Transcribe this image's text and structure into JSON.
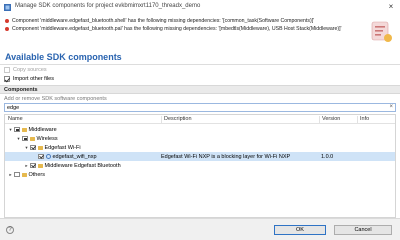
{
  "window": {
    "title": "Manage SDK components for project evkbmimxrt1170_threadx_demo",
    "icon": "app-icon",
    "close_label": "×"
  },
  "warnings": [
    "Component 'middleware.edgefast_bluetooth.shell' has the following missing dependencies: '[common_task(Software Components)]'",
    "Component 'middleware.edgefast_bluetooth.pal' has the following missing dependencies: '[mbedtls(Middleware), USB Host Stack(Middleware)]'"
  ],
  "page_title": "Available SDK components",
  "options": {
    "copy_sources": {
      "label": "Copy sources",
      "checked": false,
      "enabled": false
    },
    "import_other_files": {
      "label": "Import other files",
      "checked": true,
      "enabled": true
    }
  },
  "components_section": {
    "title": "Components",
    "subtitle": "Add or remove SDK software components",
    "filter_value": "edge",
    "clear_label": "×"
  },
  "table": {
    "columns": [
      "Name",
      "Description",
      "Version",
      "Info"
    ],
    "rows": [
      {
        "name": "Middleware",
        "description": "",
        "version": "",
        "info": ""
      },
      {
        "name": "Wireless",
        "description": "",
        "version": "",
        "info": ""
      },
      {
        "name": "Edgefast Wi-Fi",
        "description": "",
        "version": "",
        "info": ""
      },
      {
        "name": "edgefast_wifi_nxp",
        "description": "Edgefast Wi-Fi NXP is a blocking layer for Wi-Fi NXP",
        "version": "1.0.0",
        "info": ""
      },
      {
        "name": "Middleware Edgefast Bluetooth",
        "description": "",
        "version": "",
        "info": ""
      },
      {
        "name": "Others",
        "description": "",
        "version": "",
        "info": ""
      }
    ]
  },
  "buttons": {
    "ok": "OK",
    "cancel": "Cancel",
    "help": "?"
  },
  "colors": {
    "title_blue": "#2a64b0",
    "error_red": "#d53a2e",
    "selection": "#cfe3f7"
  }
}
